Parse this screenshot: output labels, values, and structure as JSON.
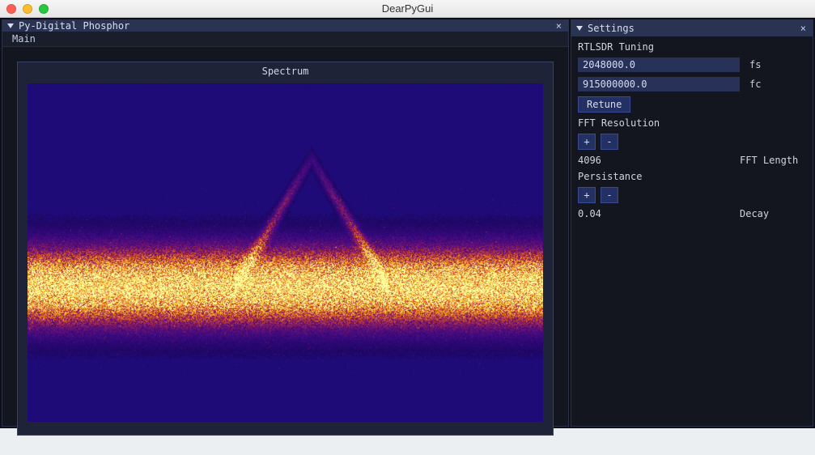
{
  "app": {
    "title": "DearPyGui"
  },
  "main_window": {
    "title": "Py-Digital Phosphor",
    "menu": {
      "main": "Main"
    },
    "plot": {
      "title": "Spectrum"
    }
  },
  "settings_window": {
    "title": "Settings",
    "section_tuning": "RTLSDR Tuning",
    "fs_value": "2048000.0",
    "fs_label": "fs",
    "fc_value": "915000000.0",
    "fc_label": "fc",
    "retune_label": "Retune",
    "section_fft": "FFT Resolution",
    "plus_label": "+",
    "minus_label": "-",
    "fft_length_value": "4096",
    "fft_length_label": "FFT Length",
    "section_persist": "Persistance",
    "decay_value": "0.04",
    "decay_label": "Decay"
  },
  "chart_data": {
    "type": "heatmap",
    "title": "Spectrum",
    "xlabel": "",
    "ylabel": "",
    "x_range": [
      0,
      1
    ],
    "y_range": [
      0,
      1
    ],
    "noise_floor_band": {
      "center_y": 0.4,
      "half_height": 0.12
    },
    "peak": {
      "center_x": 0.55,
      "base_half_width": 0.15,
      "apex_y": 0.78
    },
    "colormap": "inferno"
  }
}
